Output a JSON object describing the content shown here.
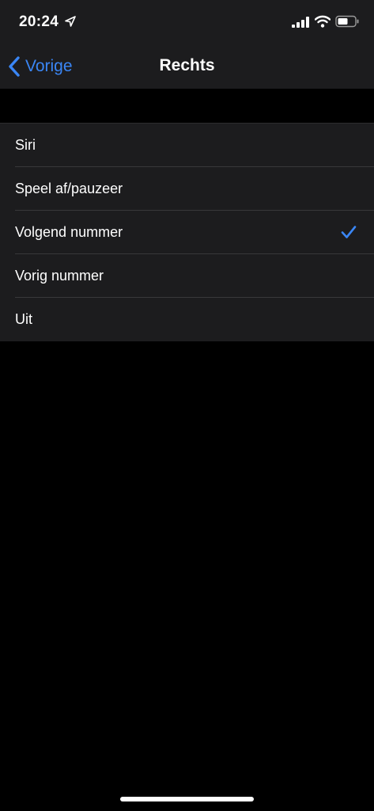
{
  "status_bar": {
    "time": "20:24",
    "icons": [
      "location-arrow-icon",
      "cellular-signal-icon",
      "wifi-icon",
      "battery-icon"
    ]
  },
  "nav": {
    "back_label": "Vorige",
    "title": "Rechts"
  },
  "options": [
    {
      "label": "Siri",
      "selected": false
    },
    {
      "label": "Speel af/pauzeer",
      "selected": false
    },
    {
      "label": "Volgend nummer",
      "selected": true
    },
    {
      "label": "Vorig nummer",
      "selected": false
    },
    {
      "label": "Uit",
      "selected": false
    }
  ],
  "colors": {
    "accent": "#3a86f5",
    "background": "#000000",
    "cell_background": "#1c1c1e",
    "separator": "#38383a"
  }
}
